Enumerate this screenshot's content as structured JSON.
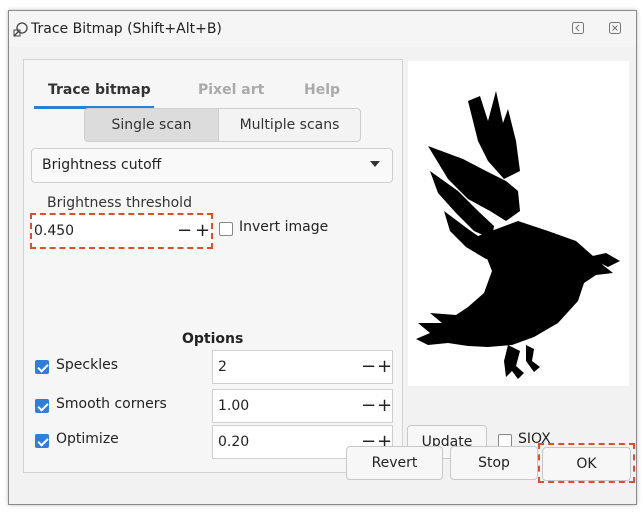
{
  "window": {
    "title": "Trace Bitmap (Shift+Alt+B)",
    "icons": {
      "app": "trace-bitmap-icon",
      "minimize": "minimize-icon",
      "close": "close-icon"
    }
  },
  "tabs": [
    {
      "label": "Trace bitmap",
      "active": true
    },
    {
      "label": "Pixel art",
      "active": false
    },
    {
      "label": "Help",
      "active": false
    }
  ],
  "scan_mode": {
    "single": "Single scan",
    "multiple": "Multiple scans",
    "selected": "Single scan"
  },
  "mode_dropdown": {
    "selected": "Brightness cutoff"
  },
  "brightness": {
    "label": "Brightness threshold",
    "value": "0.450",
    "minus": "−",
    "plus": "+"
  },
  "invert": {
    "label": "Invert image",
    "checked": false
  },
  "options": {
    "heading": "Options",
    "items": [
      {
        "label": "Speckles",
        "checked": true,
        "value": "2"
      },
      {
        "label": "Smooth corners",
        "checked": true,
        "value": "1.00"
      },
      {
        "label": "Optimize",
        "checked": true,
        "value": "0.20"
      }
    ]
  },
  "preview": {
    "icon": "crow-silhouette"
  },
  "update": {
    "label": "Update"
  },
  "siox": {
    "label": "SIOX",
    "checked": false
  },
  "footer": {
    "revert": "Revert",
    "stop": "Stop",
    "ok": "OK"
  },
  "colors": {
    "accent": "#2f7fd4",
    "highlight": "#d9512c"
  }
}
